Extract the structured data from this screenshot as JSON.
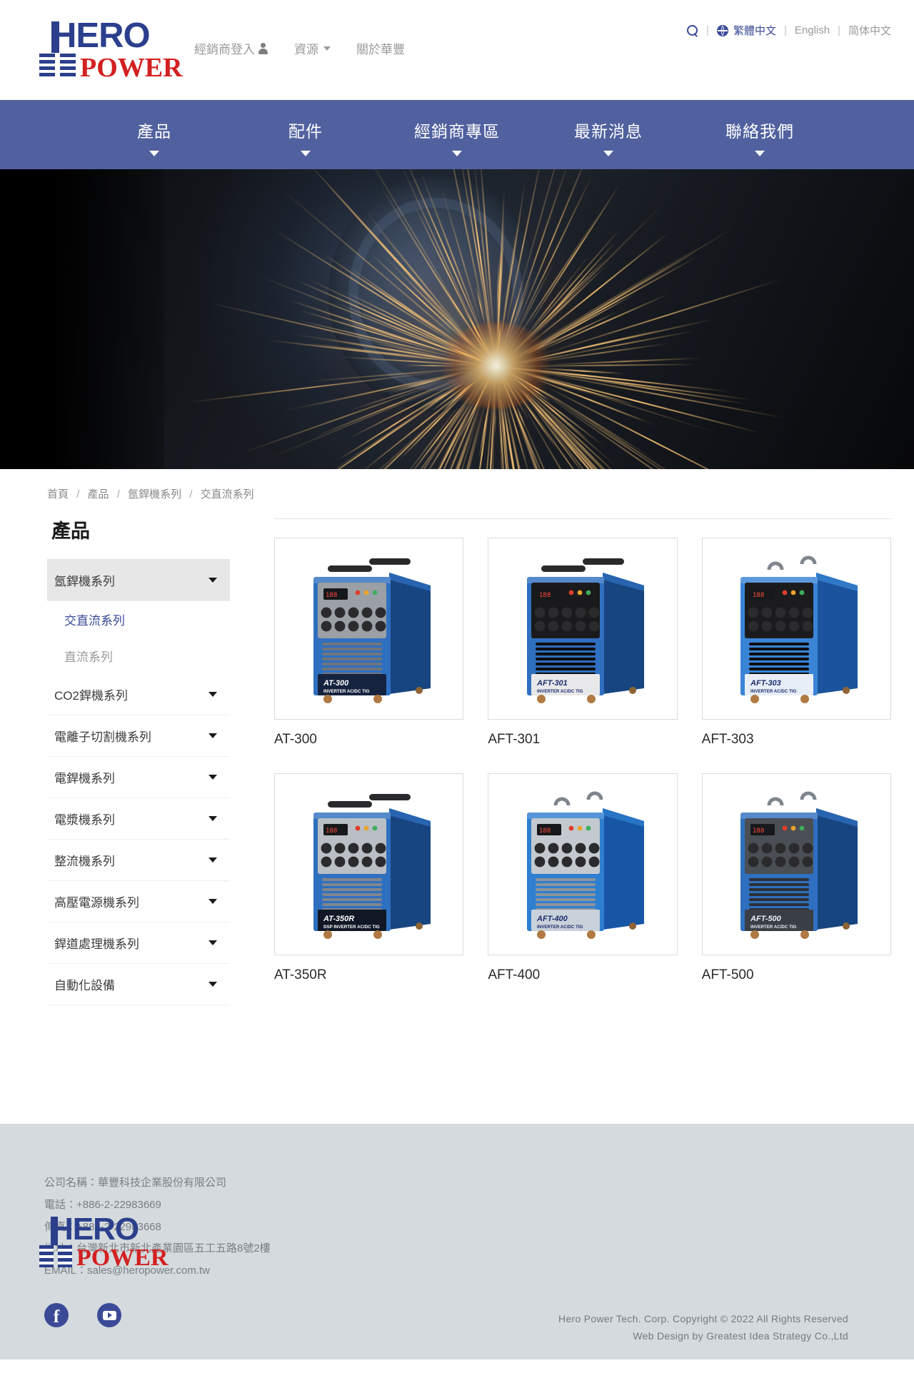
{
  "brand": {
    "logo_primary": "HERO",
    "logo_secondary": "POWER",
    "logo_primary_color": "#2b3f8c",
    "logo_secondary_color": "#d32020"
  },
  "topbar": {
    "links": [
      {
        "label": "經銷商登入",
        "icon": "person-icon",
        "has_caret": false
      },
      {
        "label": "資源",
        "icon": null,
        "has_caret": true
      },
      {
        "label": "關於華豐",
        "icon": null,
        "has_caret": false
      }
    ],
    "search_icon": "search-icon",
    "globe_icon": "globe-icon",
    "languages": [
      {
        "label": "繁體中文",
        "active": true
      },
      {
        "label": "English",
        "active": false
      },
      {
        "label": "简体中文",
        "active": false
      }
    ],
    "separator": "|"
  },
  "mainnav": {
    "background": "#51619f",
    "items": [
      {
        "label": "產品"
      },
      {
        "label": "配件"
      },
      {
        "label": "經銷商專區"
      },
      {
        "label": "最新消息"
      },
      {
        "label": "聯絡我們"
      }
    ]
  },
  "breadcrumb": {
    "separator": "/",
    "items": [
      {
        "label": "首頁"
      },
      {
        "label": "產品"
      },
      {
        "label": "氬銲機系列"
      },
      {
        "label": "交直流系列"
      }
    ]
  },
  "sidebar": {
    "title": "產品",
    "items": [
      {
        "label": "氬銲機系列",
        "expanded": true,
        "type": "group"
      },
      {
        "label": "交直流系列",
        "type": "sub",
        "active": true
      },
      {
        "label": "直流系列",
        "type": "sub",
        "active": false
      },
      {
        "label": "CO2銲機系列",
        "expanded": false,
        "type": "group"
      },
      {
        "label": "電離子切割機系列",
        "expanded": false,
        "type": "group"
      },
      {
        "label": "電銲機系列",
        "expanded": false,
        "type": "group"
      },
      {
        "label": "電漿機系列",
        "expanded": false,
        "type": "group"
      },
      {
        "label": "整流機系列",
        "expanded": false,
        "type": "group"
      },
      {
        "label": "高壓電源機系列",
        "expanded": false,
        "type": "group"
      },
      {
        "label": "銲道處理機系列",
        "expanded": false,
        "type": "group"
      },
      {
        "label": "自動化設備",
        "expanded": false,
        "type": "group"
      }
    ]
  },
  "products": [
    {
      "name": "AT-300",
      "style": "grey-panel",
      "panel_text": "AT-300",
      "panel_sub": "INVERTER AC/DC TIG"
    },
    {
      "name": "AFT-301",
      "style": "black-panel",
      "panel_text": "AFT-301",
      "panel_sub": "INVERTER AC/DC TIG"
    },
    {
      "name": "AFT-303",
      "style": "blue-panel",
      "panel_text": "AFT-303",
      "panel_sub": "INVERTER AC/DC TIG"
    },
    {
      "name": "AT-350R",
      "style": "screen-panel",
      "panel_text": "AT-350R",
      "panel_sub": "DSP INVERTER AC/DC TIG"
    },
    {
      "name": "AFT-400",
      "style": "grey-front",
      "panel_text": "AFT-400",
      "panel_sub": "INVERTER AC/DC TIG"
    },
    {
      "name": "AFT-500",
      "style": "dark-front",
      "panel_text": "AFT-500",
      "panel_sub": "INVERTER AC/DC TIG"
    }
  ],
  "footer": {
    "background": "#d4dadd",
    "contact": [
      "公司名稱：華豐科技企業股份有限公司",
      "電話：+886-2-22983669",
      "傳真：+886-2-22983668",
      "地址：台灣新北市新北產業園區五工五路8號2樓",
      "EMAIL：sales@heropower.com.tw"
    ],
    "social": [
      {
        "name": "facebook",
        "glyph": "f"
      },
      {
        "name": "youtube",
        "glyph": "▶"
      }
    ],
    "copyright_line1": "Hero Power Tech. Corp. Copyright © 2022 All Rights Reserved",
    "copyright_line2": "Web Design by Greatest Idea Strategy Co.,Ltd"
  }
}
